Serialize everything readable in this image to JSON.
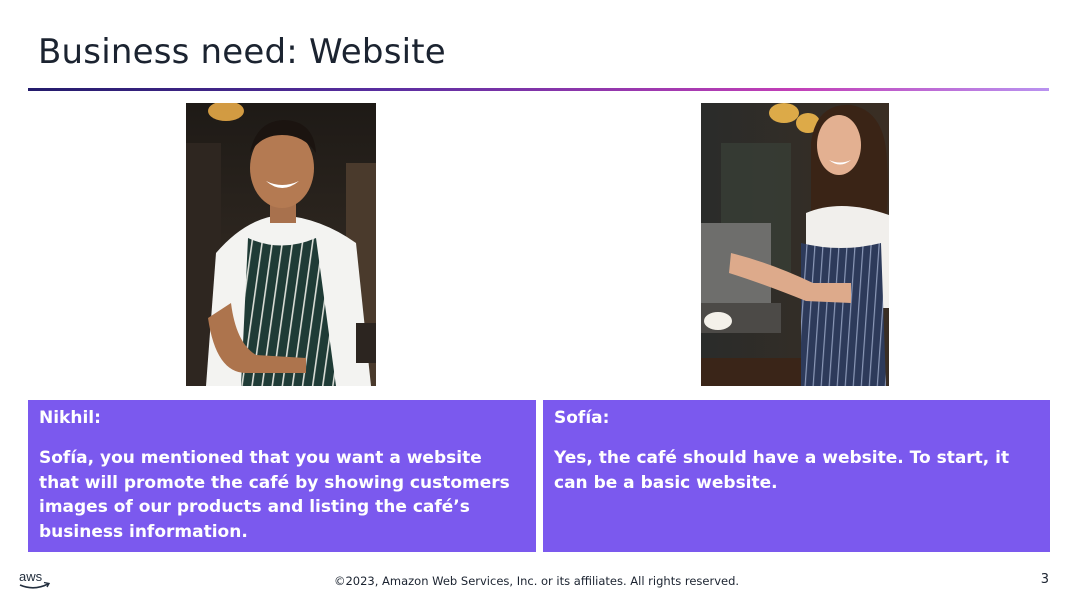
{
  "slide": {
    "title": "Business need: Website",
    "page_number": "3",
    "footer": "©2023, Amazon Web Services, Inc. or its affiliates. All rights reserved.",
    "logo_text": "aws"
  },
  "people": [
    {
      "speaker": "Nikhil:",
      "quote": "Sofía, you mentioned that you want a website that will promote the café by showing customers images of our products and listing the café’s business information."
    },
    {
      "speaker": "Sofía:",
      "quote": "Yes, the café should have a website. To start, it can be a basic website."
    }
  ],
  "colors": {
    "card": "#7b59ee",
    "title": "#1b2330",
    "rule_start": "#231b6b",
    "rule_end": "#b993f0"
  }
}
